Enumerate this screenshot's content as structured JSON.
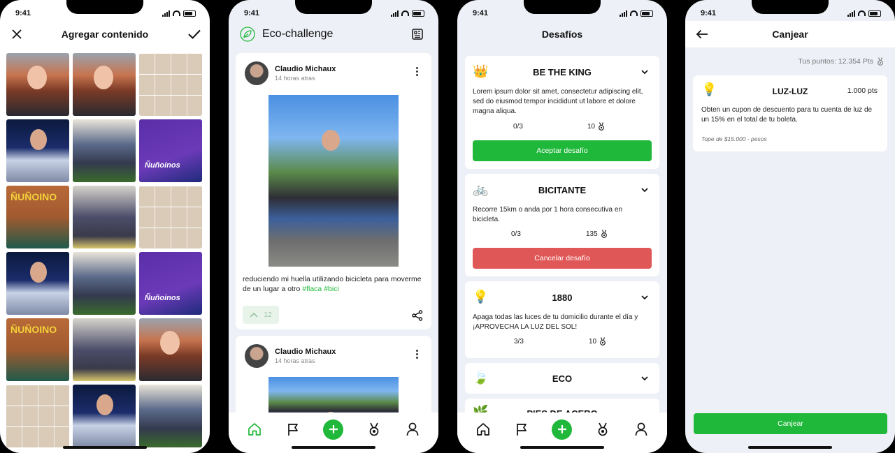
{
  "status_time": "9:41",
  "screen1": {
    "title": "Agregar contenido",
    "tiles": [
      "red",
      "red",
      "faces",
      "mic",
      "bike",
      "purple",
      "orange",
      "street",
      "faces",
      "mic",
      "bike",
      "purple",
      "orange",
      "street",
      "red",
      "faces",
      "mic",
      "bike"
    ]
  },
  "screen2": {
    "title": "Eco-challenge",
    "posts": [
      {
        "user": "Claudio Michaux",
        "time": "14 horas atras",
        "caption": "reduciendo mi huella utilizando bicicleta para moverme de un lugar a otro",
        "tag1": "#flaca",
        "tag2": "#bici",
        "upvotes": "12"
      },
      {
        "user": "Claudio Michaux",
        "time": "14 horas atras"
      }
    ]
  },
  "screen3": {
    "title": "Desafíos",
    "challenges": [
      {
        "icon": "👑",
        "title": "BE THE KING",
        "desc": "Lorem ipsum dolor sit amet, consectetur adipiscing elit, sed do eiusmod tempor incididunt ut labore et dolore magna aliqua.",
        "progress": "0/3",
        "points": "10",
        "button": "Aceptar desafío"
      },
      {
        "icon": "🚲",
        "title": "BICITANTE",
        "desc": "Recorre 15km o anda por 1 hora consecutiva en bicicleta.",
        "progress": "0/3",
        "points": "135",
        "button": "Cancelar desafío"
      },
      {
        "icon": "💡",
        "title": "1880",
        "desc": "Apaga todas las luces de tu domicilio durante el día y ¡APROVECHA LA LUZ DEL SOL!",
        "progress": "3/3",
        "points": "10"
      },
      {
        "icon": "🍃",
        "title": "ECO"
      },
      {
        "icon": "🌿",
        "title": "PIES DE ACERO"
      }
    ]
  },
  "screen4": {
    "title": "Canjear",
    "points": "Tus puntos: 12.354 Pts",
    "reward": {
      "icon": "💡",
      "title": "LUZ-LUZ",
      "pts": "1.000 pts",
      "desc": "Obten un cupon de descuento para tu cuenta de luz de un 15% en el total de tu boleta.",
      "cap": "Tope de $15.000 - pesos"
    },
    "button": "Canjear"
  },
  "colors": {
    "accent": "#1fb83a",
    "danger": "#e05757",
    "background": "#eef0f7"
  }
}
